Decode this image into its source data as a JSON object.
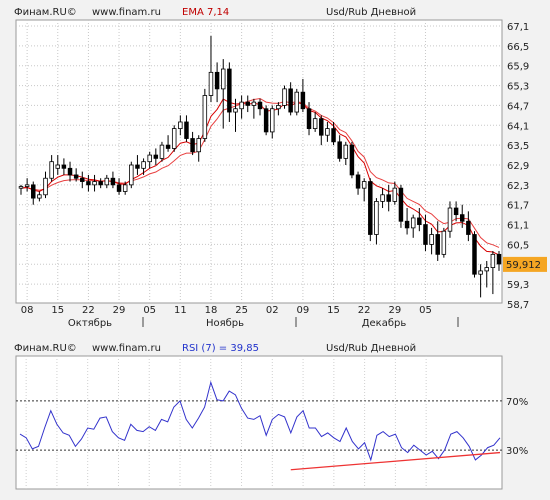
{
  "chart_data": [
    {
      "type": "candlestick",
      "source": "Финам.RU©",
      "site": "www.finam.ru",
      "indicator_label": "EMA 7,14",
      "title": "Usd/Rub Дневной",
      "y_ticks": [
        "67,1",
        "66,5",
        "65,9",
        "65,3",
        "64,7",
        "64,1",
        "63,5",
        "62,9",
        "62,3",
        "61,7",
        "61,1",
        "60,5",
        "59,9",
        "59,3",
        "58,7"
      ],
      "ylim": [
        58.7,
        67.1
      ],
      "last_price_label": "59,912",
      "last_price": 59.912,
      "x_ticks": [
        "08",
        "15",
        "22",
        "29",
        "05",
        "11",
        "18",
        "25",
        "02",
        "09",
        "15",
        "22",
        "29",
        "05"
      ],
      "months": [
        "Октябрь",
        "Ноябрь",
        "Декабрь"
      ],
      "candles": [
        [
          62.2,
          62.3,
          62.0,
          62.25
        ],
        [
          62.25,
          62.5,
          62.1,
          62.3
        ],
        [
          62.3,
          62.4,
          61.7,
          61.9
        ],
        [
          61.9,
          62.1,
          61.8,
          62.0
        ],
        [
          62.0,
          62.7,
          61.9,
          62.5
        ],
        [
          62.5,
          63.2,
          62.4,
          63.0
        ],
        [
          62.8,
          63.2,
          62.6,
          62.9
        ],
        [
          62.9,
          63.1,
          62.6,
          62.8
        ],
        [
          62.8,
          63.0,
          62.4,
          62.6
        ],
        [
          62.6,
          62.8,
          62.4,
          62.5
        ],
        [
          62.5,
          62.7,
          62.2,
          62.4
        ],
        [
          62.4,
          62.6,
          62.1,
          62.3
        ],
        [
          62.3,
          62.6,
          62.1,
          62.4
        ],
        [
          62.4,
          62.5,
          62.2,
          62.3
        ],
        [
          62.3,
          62.6,
          62.2,
          62.5
        ],
        [
          62.5,
          62.7,
          62.2,
          62.3
        ],
        [
          62.3,
          62.5,
          62.0,
          62.1
        ],
        [
          62.1,
          62.4,
          62.0,
          62.3
        ],
        [
          62.3,
          63.0,
          62.2,
          62.9
        ],
        [
          62.9,
          63.2,
          62.6,
          62.8
        ],
        [
          62.8,
          63.1,
          62.6,
          63.0
        ],
        [
          63.0,
          63.3,
          62.8,
          63.2
        ],
        [
          63.2,
          63.4,
          62.9,
          63.1
        ],
        [
          63.1,
          63.6,
          63.0,
          63.5
        ],
        [
          63.5,
          63.8,
          63.3,
          63.4
        ],
        [
          63.4,
          64.1,
          63.3,
          64.0
        ],
        [
          64.0,
          64.4,
          63.8,
          64.2
        ],
        [
          64.2,
          64.4,
          63.6,
          63.7
        ],
        [
          63.7,
          63.9,
          63.2,
          63.3
        ],
        [
          63.3,
          63.8,
          63.0,
          63.7
        ],
        [
          63.7,
          65.2,
          63.6,
          65.0
        ],
        [
          65.0,
          66.8,
          64.8,
          65.7
        ],
        [
          65.7,
          66.0,
          64.8,
          65.2
        ],
        [
          65.2,
          66.1,
          64.0,
          65.8
        ],
        [
          65.8,
          66.0,
          64.2,
          64.5
        ],
        [
          64.5,
          64.9,
          63.9,
          64.6
        ],
        [
          64.6,
          65.0,
          64.3,
          64.8
        ],
        [
          64.8,
          65.0,
          64.5,
          64.7
        ],
        [
          64.7,
          64.9,
          64.3,
          64.8
        ],
        [
          64.8,
          64.9,
          64.4,
          64.6
        ],
        [
          64.6,
          64.7,
          63.8,
          63.9
        ],
        [
          63.9,
          64.7,
          63.7,
          64.6
        ],
        [
          64.6,
          64.8,
          64.4,
          64.7
        ],
        [
          64.7,
          65.3,
          64.6,
          65.2
        ],
        [
          65.2,
          65.4,
          64.4,
          64.5
        ],
        [
          64.5,
          65.2,
          64.4,
          65.1
        ],
        [
          65.1,
          65.5,
          64.5,
          64.6
        ],
        [
          64.6,
          64.8,
          63.8,
          64.0
        ],
        [
          64.0,
          64.5,
          63.9,
          64.3
        ],
        [
          64.3,
          64.4,
          63.5,
          63.8
        ],
        [
          63.8,
          64.2,
          63.6,
          64.0
        ],
        [
          64.0,
          64.2,
          63.5,
          63.6
        ],
        [
          63.6,
          63.8,
          63.0,
          63.1
        ],
        [
          63.1,
          63.6,
          62.9,
          63.5
        ],
        [
          63.5,
          63.6,
          62.5,
          62.6
        ],
        [
          62.6,
          62.7,
          62.0,
          62.2
        ],
        [
          62.2,
          62.5,
          61.8,
          62.4
        ],
        [
          62.4,
          62.5,
          60.6,
          60.8
        ],
        [
          60.8,
          61.9,
          60.5,
          61.8
        ],
        [
          61.8,
          62.2,
          61.6,
          62.0
        ],
        [
          62.0,
          62.3,
          61.5,
          61.8
        ],
        [
          61.8,
          62.4,
          61.7,
          62.2
        ],
        [
          62.2,
          62.3,
          61.0,
          61.2
        ],
        [
          61.2,
          61.6,
          60.8,
          61.0
        ],
        [
          61.0,
          61.4,
          60.7,
          61.3
        ],
        [
          61.3,
          61.6,
          60.9,
          61.1
        ],
        [
          61.1,
          61.4,
          60.3,
          60.5
        ],
        [
          60.5,
          61.0,
          60.2,
          60.8
        ],
        [
          60.8,
          61.2,
          60.0,
          60.2
        ],
        [
          60.2,
          61.0,
          60.1,
          60.9
        ],
        [
          60.9,
          61.8,
          60.7,
          61.6
        ],
        [
          61.6,
          61.8,
          61.2,
          61.4
        ],
        [
          61.4,
          61.7,
          61.0,
          61.2
        ],
        [
          61.2,
          61.5,
          60.6,
          60.8
        ],
        [
          60.8,
          60.9,
          59.5,
          59.6
        ],
        [
          59.6,
          59.9,
          58.9,
          59.7
        ],
        [
          59.7,
          60.0,
          59.2,
          59.8
        ],
        [
          59.8,
          60.3,
          59.0,
          60.2
        ],
        [
          60.2,
          60.3,
          59.7,
          59.91
        ]
      ],
      "ema_fast": [
        62.2,
        62.23,
        62.14,
        62.1,
        62.2,
        62.4,
        62.53,
        62.6,
        62.6,
        62.58,
        62.53,
        62.47,
        62.45,
        62.41,
        62.43,
        62.4,
        62.33,
        62.32,
        62.46,
        62.55,
        62.67,
        62.8,
        62.88,
        63.04,
        63.13,
        63.35,
        63.56,
        63.6,
        63.52,
        63.56,
        63.92,
        64.37,
        64.58,
        64.89,
        64.79,
        64.74,
        64.76,
        64.74,
        64.76,
        64.73,
        64.53,
        64.55,
        64.59,
        64.75,
        64.69,
        64.79,
        64.74,
        64.55,
        64.49,
        64.32,
        64.24,
        64.08,
        63.84,
        63.75,
        63.47,
        63.15,
        62.96,
        62.42,
        62.27,
        62.2,
        62.1,
        62.13,
        61.89,
        61.67,
        61.57,
        61.45,
        61.21,
        61.11,
        60.88,
        60.89,
        61.07,
        61.15,
        61.16,
        61.07,
        60.7,
        60.45,
        60.29,
        60.27,
        60.18
      ],
      "ema_slow": [
        62.2,
        62.21,
        62.17,
        62.14,
        62.18,
        62.29,
        62.37,
        62.43,
        62.45,
        62.46,
        62.45,
        62.43,
        62.43,
        62.41,
        62.42,
        62.4,
        62.36,
        62.35,
        62.42,
        62.47,
        62.54,
        62.63,
        62.69,
        62.8,
        62.88,
        63.03,
        63.19,
        63.26,
        63.26,
        63.32,
        63.67,
        64.07,
        64.29,
        64.56,
        64.62,
        64.68,
        64.76,
        64.82,
        64.88,
        64.91,
        64.8,
        64.77,
        64.76,
        64.82,
        64.78,
        64.81,
        64.78,
        64.61,
        64.53,
        64.4,
        64.32,
        64.18,
        63.97,
        63.88,
        63.63,
        63.31,
        63.14,
        62.7,
        62.52,
        62.45,
        62.36,
        62.34,
        62.12,
        61.89,
        61.8,
        61.71,
        61.51,
        61.42,
        61.24,
        61.13,
        61.17,
        61.28,
        61.29,
        61.27,
        60.99,
        60.71,
        60.55,
        60.49,
        60.41
      ]
    },
    {
      "type": "line",
      "source": "Финам.RU©",
      "site": "www.finam.ru",
      "indicator_label": "RSI (7) = 39,85",
      "title": "Usd/Rub Дневной",
      "y_ticks": [
        "70%",
        "30%"
      ],
      "levels": [
        70,
        30
      ],
      "ylim": [
        0,
        100
      ],
      "rsi": [
        43,
        40,
        31,
        33,
        48,
        62,
        51,
        44,
        42,
        33,
        39,
        48,
        47,
        56,
        57,
        45,
        40,
        38,
        51,
        46,
        45,
        49,
        46,
        55,
        53,
        65,
        70,
        55,
        48,
        56,
        65,
        85,
        71,
        70,
        78,
        75,
        64,
        56,
        55,
        58,
        42,
        55,
        59,
        57,
        44,
        57,
        62,
        48,
        48,
        41,
        44,
        40,
        37,
        48,
        37,
        31,
        36,
        22,
        42,
        45,
        41,
        43,
        32,
        28,
        34,
        30,
        26,
        29,
        23,
        30,
        43,
        45,
        40,
        33,
        22,
        26,
        32,
        34,
        40
      ],
      "support_line": {
        "x": [
          44,
          78
        ],
        "y": [
          14,
          28
        ]
      }
    }
  ],
  "colors": {
    "candle_body": "#000000",
    "ema_fast": "#d80000",
    "ema_slow": "#e84040",
    "rsi_line": "#3333cc",
    "support_line": "#ee3333",
    "price_label_bg": "#f5a623",
    "indicator_text": "#c00000",
    "rsi_text": "#2233cc"
  }
}
